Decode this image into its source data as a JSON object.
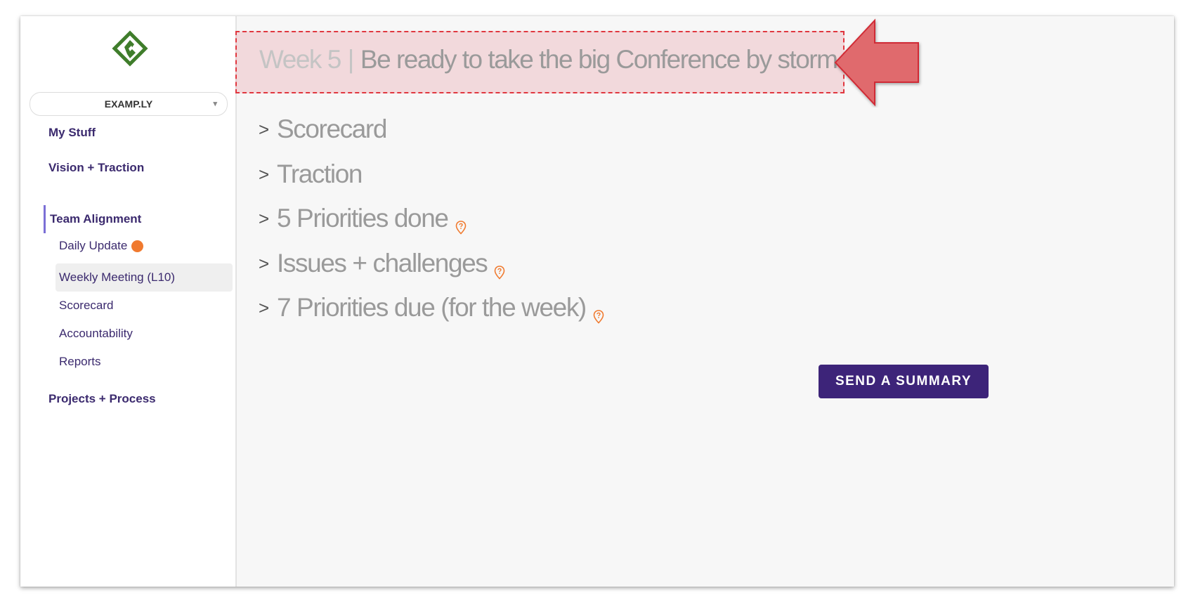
{
  "org_selector": {
    "value": "EXAMP.LY"
  },
  "nav": {
    "top_items": [
      {
        "label": "My Stuff"
      },
      {
        "label": "Vision + Traction"
      },
      {
        "label": "Team Alignment"
      },
      {
        "label": "Projects + Process"
      }
    ],
    "team_alignment_items": [
      {
        "label": "Daily Update",
        "has_notification": true
      },
      {
        "label": "Weekly Meeting (L10)",
        "selected": true
      },
      {
        "label": "Scorecard"
      },
      {
        "label": "Accountability"
      },
      {
        "label": "Reports"
      }
    ]
  },
  "meeting": {
    "week_label": "Week 5",
    "separator": "|",
    "theme": "Be ready to take the big Conference by storm"
  },
  "sections": [
    {
      "label": "Scorecard",
      "help": false
    },
    {
      "label": "Traction",
      "help": false
    },
    {
      "label": "5 Priorities done",
      "help": true
    },
    {
      "label": "Issues + challenges",
      "help": true
    },
    {
      "label": "7 Priorities due (for the week)",
      "help": true
    }
  ],
  "chevron_glyph": ">",
  "caret_glyph": "▾",
  "send_button": {
    "label": "SEND A SUMMARY"
  },
  "colors": {
    "brand_purple": "#3d2479",
    "nav_text": "#3b2a6e",
    "accent_orange": "#f07a2f",
    "logo_green": "#3f7d2b",
    "annotation_red": "#e0373f"
  },
  "icons": {
    "logo": "diamond-logo-icon",
    "help": "help-pin-icon",
    "chevron": "chevron-right-icon",
    "annotation": "left-arrow-annotation"
  }
}
